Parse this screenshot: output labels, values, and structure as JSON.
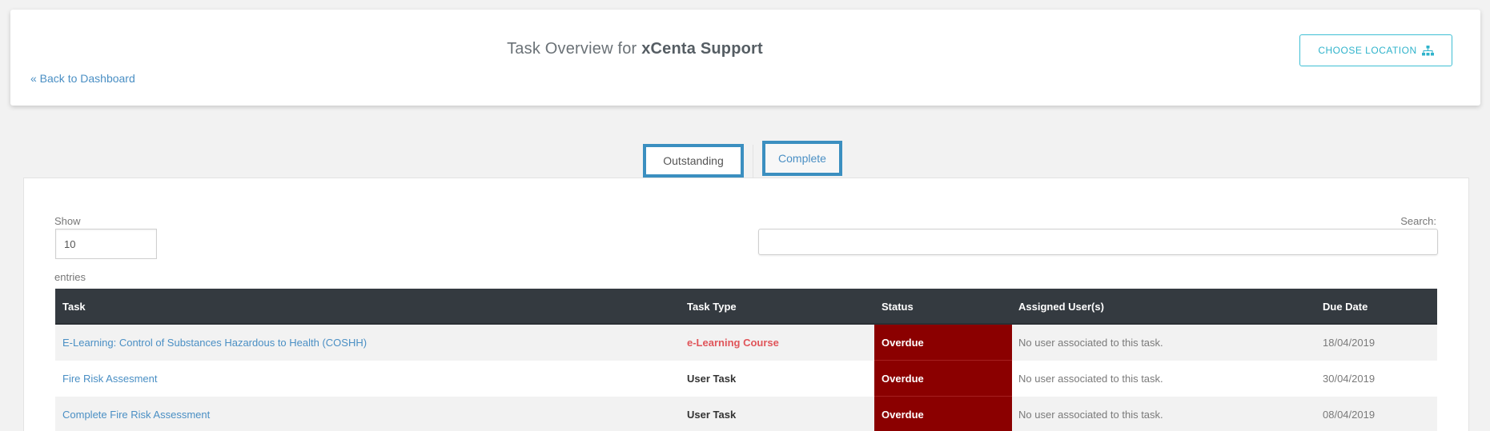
{
  "header": {
    "title_prefix": "Task Overview for",
    "title_org": "xCenta Support",
    "back_link": "« Back to Dashboard",
    "choose_location": "CHOOSE LOCATION",
    "choose_location_icon": "sitemap-icon"
  },
  "tabs": [
    {
      "label": "Outstanding",
      "active": true
    },
    {
      "label": "Complete",
      "active": false
    }
  ],
  "table_controls": {
    "show_label": "Show",
    "page_length": "10",
    "entries_label": "entries",
    "search_label": "Search:",
    "search_value": ""
  },
  "table": {
    "columns": [
      "Task",
      "Task Type",
      "Status",
      "Assigned User(s)",
      "Due Date"
    ],
    "rows": [
      {
        "task": "E-Learning: Control of Substances Hazardous to Health (COSHH)",
        "type": "e-Learning Course",
        "status": "Overdue",
        "assigned": "No user associated to this task.",
        "due": "18/04/2019"
      },
      {
        "task": "Fire Risk Assesment",
        "type": "User Task",
        "status": "Overdue",
        "assigned": "No user associated to this task.",
        "due": "30/04/2019"
      },
      {
        "task": "Complete Fire Risk Assessment",
        "type": "User Task",
        "status": "Overdue",
        "assigned": "No user associated to this task.",
        "due": "08/04/2019"
      }
    ]
  },
  "colors": {
    "accent": "#3fbfd4",
    "link": "#4a8fc4",
    "header_bg": "#343a40",
    "overdue_bg": "#8b0000",
    "elearning_type": "#e0555a"
  }
}
